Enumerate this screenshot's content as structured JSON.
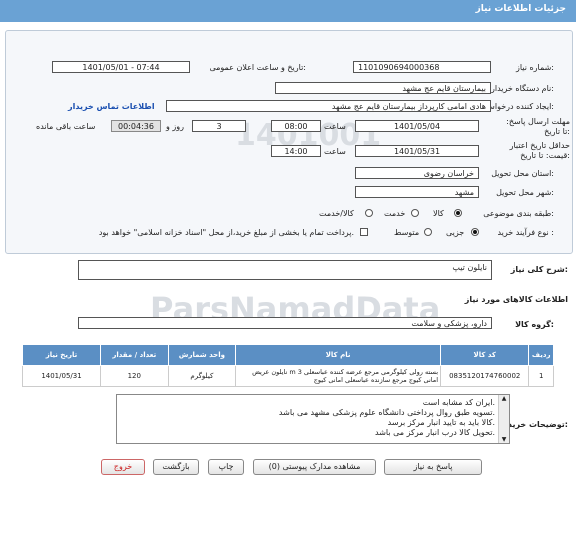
{
  "header": {
    "title": "جزئیات اطلاعات نیاز"
  },
  "fields": {
    "need_number_label": "شماره نیاز:",
    "need_number": "1101090694000368",
    "announce_label": "تاریخ و ساعت اعلان عمومی:",
    "announce_value": "1401/05/01 - 07:44",
    "buyer_label": "نام دستگاه خریدار:",
    "buyer_value": "بیمارستان قایم  عج  مشهد",
    "creator_label": "ایجاد کننده درخواست:",
    "creator_value": "هادی امامی کارپرداز بیمارستان قایم  عج  مشهد",
    "contact_link": "اطلاعات تماس خریدار",
    "deadline_label": "مهلت ارسال پاسخ: تا تاریخ:",
    "deadline_date": "1401/05/04",
    "time_label": "ساعت",
    "deadline_time": "08:00",
    "days_value": "3",
    "days_label": "روز و",
    "remaining_value": "00:04:36",
    "remaining_label": "ساعت باقی مانده",
    "price_label": "حداقل تاریخ اعتبار قیمت: تا تاریخ:",
    "price_date": "1401/05/31",
    "price_time": "14:00",
    "province_label": "استان محل تحویل:",
    "province_value": "خراسان رضوی",
    "city_label": "شهر محل تحویل:",
    "city_value": "مشهد",
    "category_label": "طبقه بندی موضوعی:",
    "category_options": [
      "کالا",
      "خدمت",
      "کالا/خدمت"
    ],
    "process_label": "نوع فرآیند خرید :",
    "process_options": [
      "جزیی",
      "متوسط"
    ],
    "payment_note": "پرداخت تمام یا بخشی از مبلغ خرید،از محل \"اسناد خزانه اسلامی\" خواهد بود."
  },
  "description": {
    "label": "شرح کلی نیاز:",
    "value": "نایلون تیپ"
  },
  "goods": {
    "section_title": "اطلاعات کالاهای مورد نیاز",
    "group_label": "گروه کالا:",
    "group_value": "دارو، پزشکی و سلامت",
    "columns": [
      "ردیف",
      "کد کالا",
      "نام کالا",
      "واحد شمارش",
      "تعداد / مقدار",
      "تاریخ نیاز"
    ],
    "rows": [
      {
        "row": "1",
        "code": "0835120174760002",
        "name": "نایلون عریض m 3 بسته رولی کیلوگرمی مرجع عرضه کننده عباسعلی امانی کیوج مرجع سازنده عباسعلی امانی کیوج",
        "unit": "کیلوگرم",
        "qty": "120",
        "date": "1401/05/31"
      }
    ]
  },
  "buyer_notes": {
    "label": "توضیحات خریدار:",
    "lines": [
      "ایران کد مشابه است.",
      "تسویه طبق روال پرداختی دانشگاه علوم پزشکی مشهد می باشد.",
      "کالا باید به تایید انبار مرکز برسد.",
      "تحویل کالا درب انبار مرکز می باشد."
    ]
  },
  "buttons": {
    "reply": "پاسخ به نیاز",
    "attachments": "مشاهده مدارک پیوستی (0)",
    "print": "چاپ",
    "back": "بازگشت",
    "exit": "خروج"
  },
  "watermark": {
    "brand": "ParsNamadData",
    "ghost_numbers": "1401001"
  }
}
